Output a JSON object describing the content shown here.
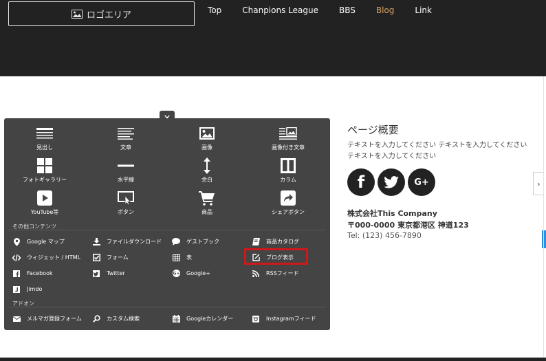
{
  "header": {
    "logo_text": "ロゴエリア",
    "nav": [
      "Top",
      "Chanpions League",
      "BBS",
      "Blog",
      "Link"
    ],
    "active_nav": "Blog",
    "active_color": "#d9a266"
  },
  "palette": {
    "close_glyph": "✕",
    "tiles": [
      {
        "label": "見出し",
        "icon": "heading-icon"
      },
      {
        "label": "文章",
        "icon": "text-icon"
      },
      {
        "label": "画像",
        "icon": "image-icon"
      },
      {
        "label": "画像付き文章",
        "icon": "image-text-icon"
      },
      {
        "label": "フォトギャラリー",
        "icon": "gallery-icon"
      },
      {
        "label": "水平線",
        "icon": "hr-icon"
      },
      {
        "label": "余白",
        "icon": "spacer-icon"
      },
      {
        "label": "カラム",
        "icon": "column-icon"
      },
      {
        "label": "YouTube等",
        "icon": "youtube-icon"
      },
      {
        "label": "ボタン",
        "icon": "button-icon"
      },
      {
        "label": "商品",
        "icon": "cart-icon"
      },
      {
        "label": "シェアボタン",
        "icon": "share-icon"
      }
    ],
    "other_label": "その他コンテンツ",
    "other_items": [
      {
        "label": "Google マップ",
        "icon": "map-pin-icon"
      },
      {
        "label": "ファイルダウンロード",
        "icon": "download-icon"
      },
      {
        "label": "ゲストブック",
        "icon": "comment-icon"
      },
      {
        "label": "商品カタログ",
        "icon": "book-icon"
      },
      {
        "label": "ウィジェット / HTML",
        "icon": "code-icon"
      },
      {
        "label": "フォーム",
        "icon": "checkbox-icon"
      },
      {
        "label": "表",
        "icon": "table-icon"
      },
      {
        "label": "ブログ表示",
        "icon": "edit-icon"
      },
      {
        "label": "Facebook",
        "icon": "facebook-icon"
      },
      {
        "label": "Twitter",
        "icon": "twitter-icon"
      },
      {
        "label": "Google+",
        "icon": "googleplus-icon"
      },
      {
        "label": "RSSフィード",
        "icon": "rss-icon"
      },
      {
        "label": "Jimdo",
        "icon": "jimdo-icon"
      }
    ],
    "addon_label": "アドオン",
    "addon_items": [
      {
        "label": "メルマガ登録フォーム",
        "icon": "mail-icon"
      },
      {
        "label": "カスタム検索",
        "icon": "search-icon"
      },
      {
        "label": "Googleカレンダー",
        "icon": "calendar-icon"
      },
      {
        "label": "Instagramフィード",
        "icon": "instagram-icon"
      }
    ],
    "highlight_color": "#d0171a"
  },
  "sidebar": {
    "title": "ページ概要",
    "description": "テキストを入力してください テキストを入力してください テキストを入力してください",
    "social": [
      {
        "glyph": "f",
        "icon": "facebook-icon"
      },
      {
        "glyph": "t",
        "icon": "twitter-icon"
      },
      {
        "glyph": "G+",
        "icon": "googleplus-icon"
      }
    ],
    "company_name": "株式会社This Company",
    "address": "〒000-0000 東京都港区 神道123",
    "tel": "Tel: (123) 456-7890",
    "toggle_glyph": "›"
  }
}
